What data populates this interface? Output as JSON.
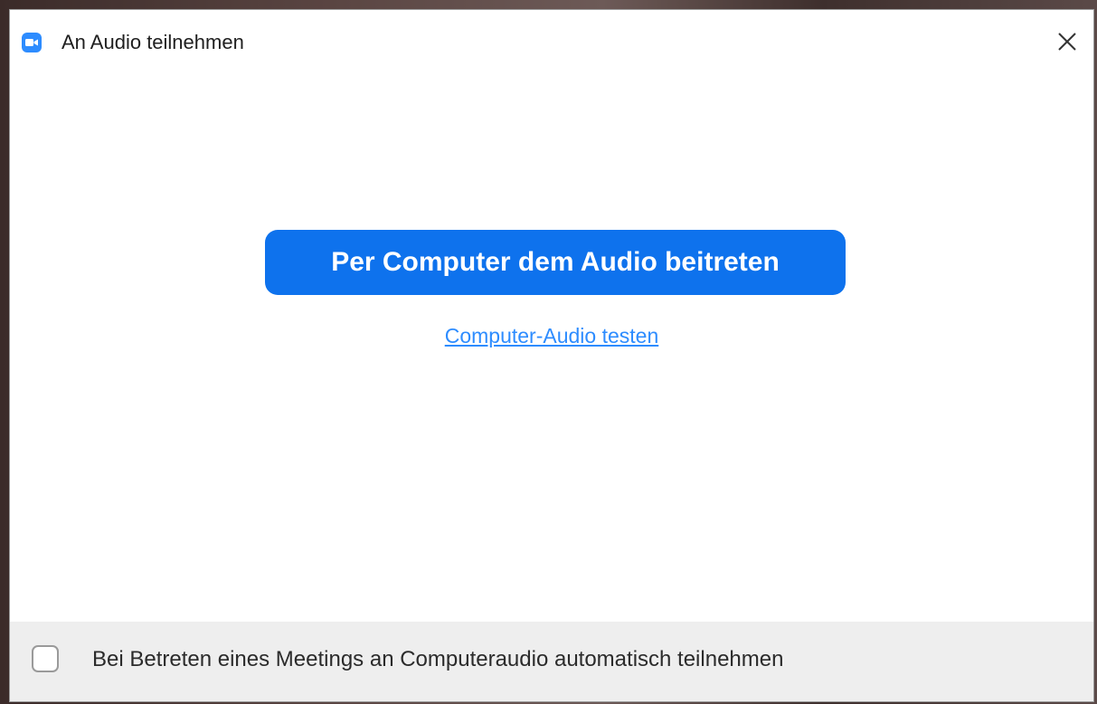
{
  "window": {
    "title": "An Audio teilnehmen",
    "app_icon": "zoom-video-camera-icon",
    "close_icon": "close-icon"
  },
  "main": {
    "join_button_label": "Per Computer dem Audio beitreten",
    "test_link_label": "Computer-Audio testen"
  },
  "footer": {
    "auto_join_label": "Bei Betreten eines Meetings an Computeraudio automatisch teilnehmen",
    "auto_join_checked": false
  },
  "colors": {
    "accent": "#0e72ed",
    "link": "#2d8cff"
  }
}
